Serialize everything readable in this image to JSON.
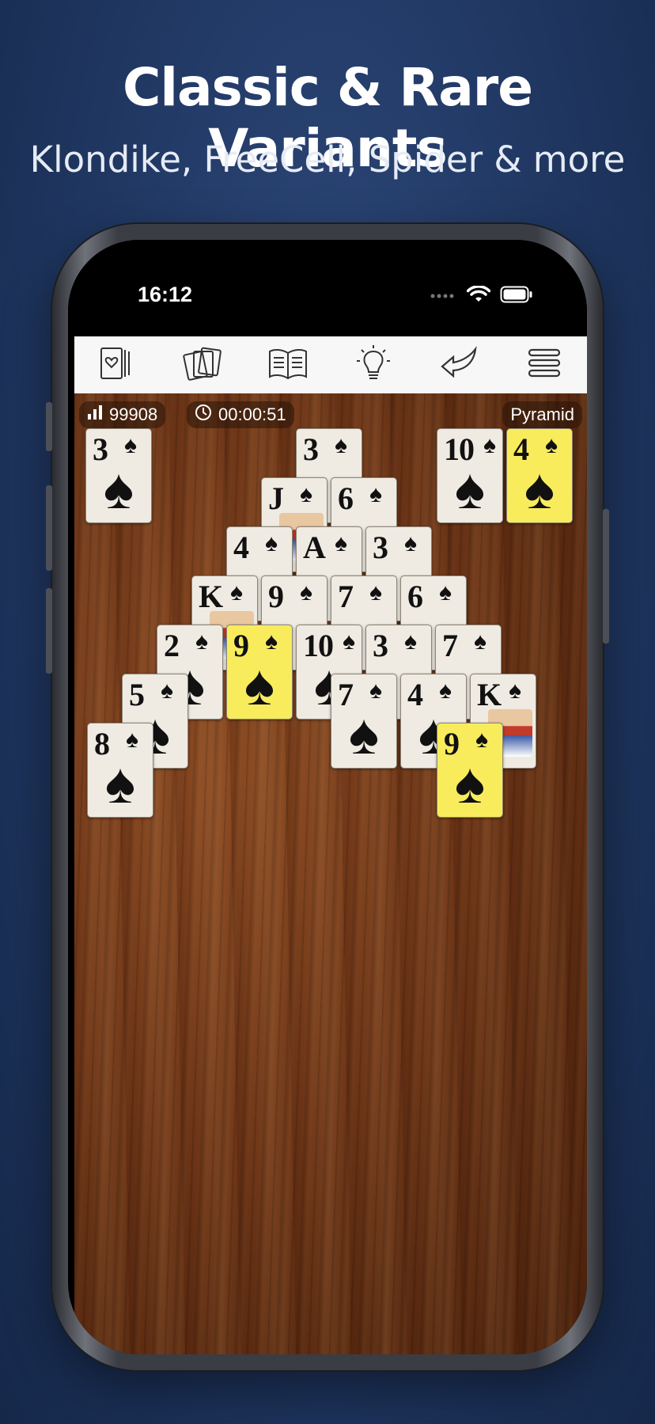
{
  "header": {
    "title": "Classic & Rare Variants",
    "subtitle": "Klondike, FreeCell, Spider & more"
  },
  "status_bar": {
    "time": "16:12"
  },
  "toolbar": {
    "buttons": [
      {
        "name": "new-game",
        "icon": "cards-deck-icon"
      },
      {
        "name": "deals",
        "icon": "card-stack-icon"
      },
      {
        "name": "rules",
        "icon": "open-book-icon"
      },
      {
        "name": "hint",
        "icon": "lightbulb-icon"
      },
      {
        "name": "undo",
        "icon": "undo-arrow-icon"
      },
      {
        "name": "menu",
        "icon": "hamburger-menu-icon"
      }
    ]
  },
  "game": {
    "score": "99908",
    "timer": "00:00:51",
    "variant": "Pyramid"
  },
  "colors": {
    "background": "#223a66",
    "card": "#efebe2",
    "highlight": "#f8ec5c",
    "toolbar": "#f7f7f7"
  },
  "cards": {
    "stock": {
      "rank": "3",
      "suit": "♠"
    },
    "waste_left": {
      "rank": "10",
      "suit": "♠"
    },
    "waste_right": {
      "rank": "4",
      "suit": "♠",
      "highlighted": true
    },
    "pyramid": [
      {
        "rank": "3",
        "suit": "♠"
      },
      {
        "rank": "J",
        "suit": "♠"
      },
      {
        "rank": "6",
        "suit": "♠"
      },
      {
        "rank": "4",
        "suit": "♠"
      },
      {
        "rank": "A",
        "suit": "♠"
      },
      {
        "rank": "3",
        "suit": "♠"
      },
      {
        "rank": "K",
        "suit": "♠"
      },
      {
        "rank": "9",
        "suit": "♠"
      },
      {
        "rank": "7",
        "suit": "♠"
      },
      {
        "rank": "6",
        "suit": "♠"
      },
      {
        "rank": "2",
        "suit": "♠"
      },
      {
        "rank": "9",
        "suit": "♠",
        "highlighted": true
      },
      {
        "rank": "10",
        "suit": "♠"
      },
      {
        "rank": "3",
        "suit": "♠"
      },
      {
        "rank": "7",
        "suit": "♠"
      },
      {
        "rank": "5",
        "suit": "♠"
      },
      {
        "rank": "7",
        "suit": "♠"
      },
      {
        "rank": "4",
        "suit": "♠"
      },
      {
        "rank": "K",
        "suit": "♠"
      },
      {
        "rank": "8",
        "suit": "♠"
      },
      {
        "rank": "9",
        "suit": "♠",
        "highlighted": true
      }
    ]
  }
}
